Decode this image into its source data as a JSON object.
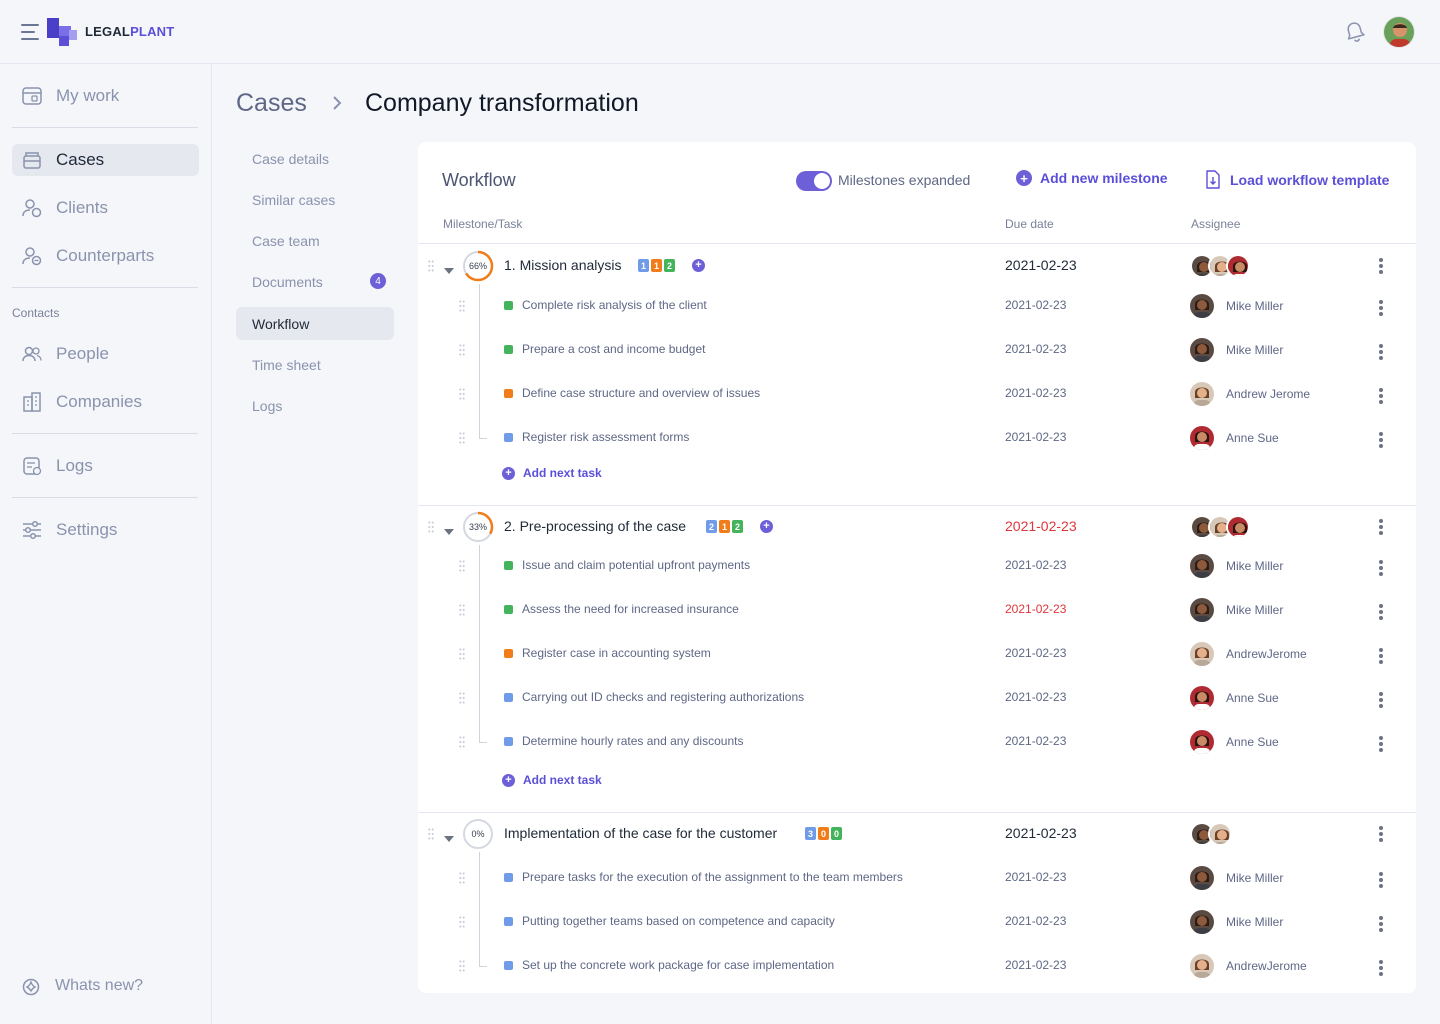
{
  "app": {
    "logo_text_a": "LEGAL",
    "logo_text_b": "PLANT",
    "brand_color": "#5b4fd8"
  },
  "sidebar": {
    "items": [
      {
        "label": "My work",
        "icon": "calendar-icon"
      },
      {
        "label": "Cases",
        "icon": "briefcase-icon",
        "active": true
      },
      {
        "label": "Clients",
        "icon": "client-icon"
      },
      {
        "label": "Counterparts",
        "icon": "counterpart-icon"
      },
      {
        "label": "People",
        "icon": "people-icon"
      },
      {
        "label": "Companies",
        "icon": "buildings-icon"
      },
      {
        "label": "Logs",
        "icon": "logs-icon"
      },
      {
        "label": "Settings",
        "icon": "sliders-icon"
      }
    ],
    "contacts_label": "Contacts",
    "whats_new": "Whats new?"
  },
  "breadcrumb": {
    "root": "Cases",
    "current": "Company transformation"
  },
  "subnav": {
    "items": [
      {
        "label": "Case details"
      },
      {
        "label": "Similar cases"
      },
      {
        "label": "Case team"
      },
      {
        "label": "Documents",
        "badge": "4"
      },
      {
        "label": "Workflow",
        "active": true
      },
      {
        "label": "Time sheet"
      },
      {
        "label": "Logs"
      }
    ]
  },
  "workflow": {
    "title": "Workflow",
    "toggle_label": "Milestones expanded",
    "add_milestone": "Add new milestone",
    "load_template": "Load workflow template",
    "col_task": "Milestone/Task",
    "col_due": "Due date",
    "col_assignee": "Assignee",
    "add_task": "Add next task",
    "milestones": [
      {
        "title": "1. Mission analysis",
        "progress_label": "66%",
        "progress": 0.66,
        "chips": [
          "1",
          "1",
          "2"
        ],
        "due": "2021-02-23",
        "late": false,
        "tasks": [
          {
            "title": "Complete risk analysis of the client",
            "status": "green",
            "due": "2021-02-23",
            "assignee": "Mike Miller"
          },
          {
            "title": "Prepare a cost and income budget",
            "status": "green",
            "due": "2021-02-23",
            "assignee": "Mike Miller"
          },
          {
            "title": "Define case structure and overview of issues",
            "status": "orange",
            "due": "2021-02-23",
            "assignee": "Andrew Jerome"
          },
          {
            "title": "Register risk assessment forms",
            "status": "blue",
            "due": "2021-02-23",
            "assignee": "Anne Sue"
          }
        ]
      },
      {
        "title": "2. Pre-processing of the case",
        "progress_label": "33%",
        "progress": 0.33,
        "chips": [
          "2",
          "1",
          "2"
        ],
        "due": "2021-02-23",
        "late": true,
        "tasks": [
          {
            "title": "Issue and claim potential upfront payments",
            "status": "green",
            "due": "2021-02-23",
            "assignee": "Mike Miller"
          },
          {
            "title": "Assess the need for increased insurance",
            "status": "green",
            "due": "2021-02-23",
            "assignee": "Mike Miller",
            "late": true
          },
          {
            "title": "Register case in accounting system",
            "status": "orange",
            "due": "2021-02-23",
            "assignee": "AndrewJerome"
          },
          {
            "title": "Carrying out ID checks and registering authorizations",
            "status": "blue",
            "due": "2021-02-23",
            "assignee": "Anne Sue"
          },
          {
            "title": "Determine hourly rates and any discounts",
            "status": "blue",
            "due": "2021-02-23",
            "assignee": "Anne Sue"
          }
        ]
      },
      {
        "title": "Implementation of the case for the customer",
        "progress_label": "0%",
        "progress": 0,
        "chips": [
          "3",
          "0",
          "0"
        ],
        "due": "2021-02-23",
        "late": false,
        "tasks": [
          {
            "title": "Prepare tasks for the execution of the assignment to the team members",
            "status": "blue",
            "due": "2021-02-23",
            "assignee": "Mike Miller"
          },
          {
            "title": "Putting together teams based on competence and capacity",
            "status": "blue",
            "due": "2021-02-23",
            "assignee": "Mike Miller"
          },
          {
            "title": "Set up the concrete work package for case implementation",
            "status": "blue",
            "due": "2021-02-23",
            "assignee": "AndrewJerome"
          }
        ]
      }
    ]
  }
}
